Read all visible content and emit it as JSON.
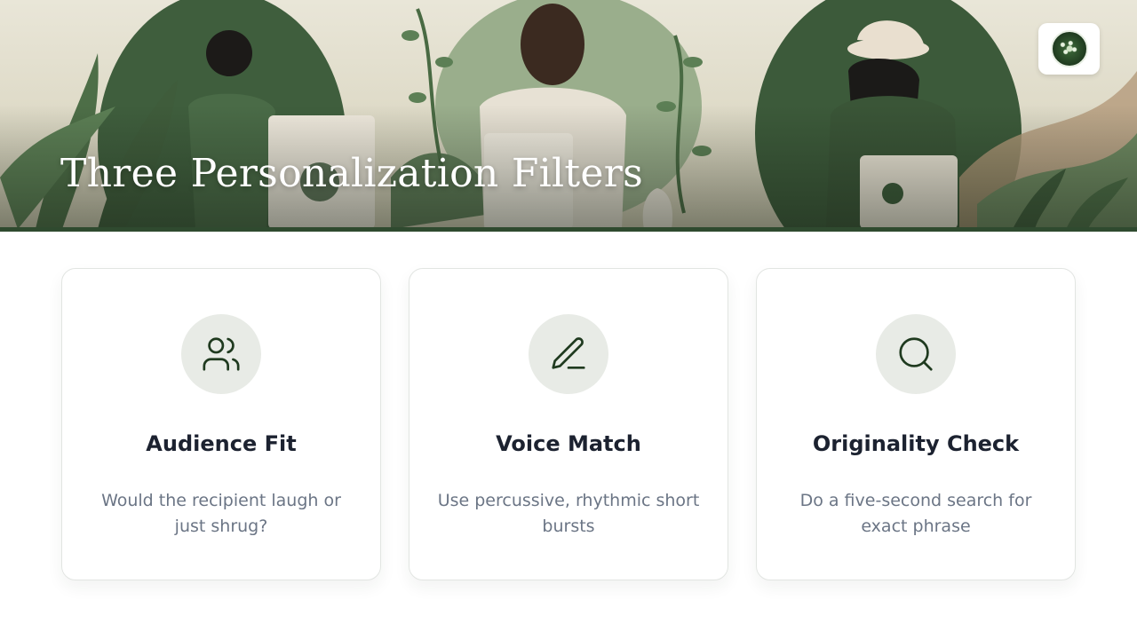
{
  "slide": {
    "title": "Three Personalization Filters",
    "logo_icon": "leaf-badge-logo"
  },
  "colors": {
    "accent_green": "#2f4a2f",
    "icon_stroke": "#1f3a1f",
    "icon_bg": "#e8ebe6",
    "title_text": "#1c2230",
    "desc_text": "#6b7585"
  },
  "cards": [
    {
      "icon": "users-icon",
      "title": "Audience Fit",
      "description": "Would the recipient laugh or just shrug?"
    },
    {
      "icon": "pen-icon",
      "title": "Voice Match",
      "description": "Use percussive, rhythmic short bursts"
    },
    {
      "icon": "search-icon",
      "title": "Originality Check",
      "description": "Do a five-second search for exact phrase"
    }
  ]
}
